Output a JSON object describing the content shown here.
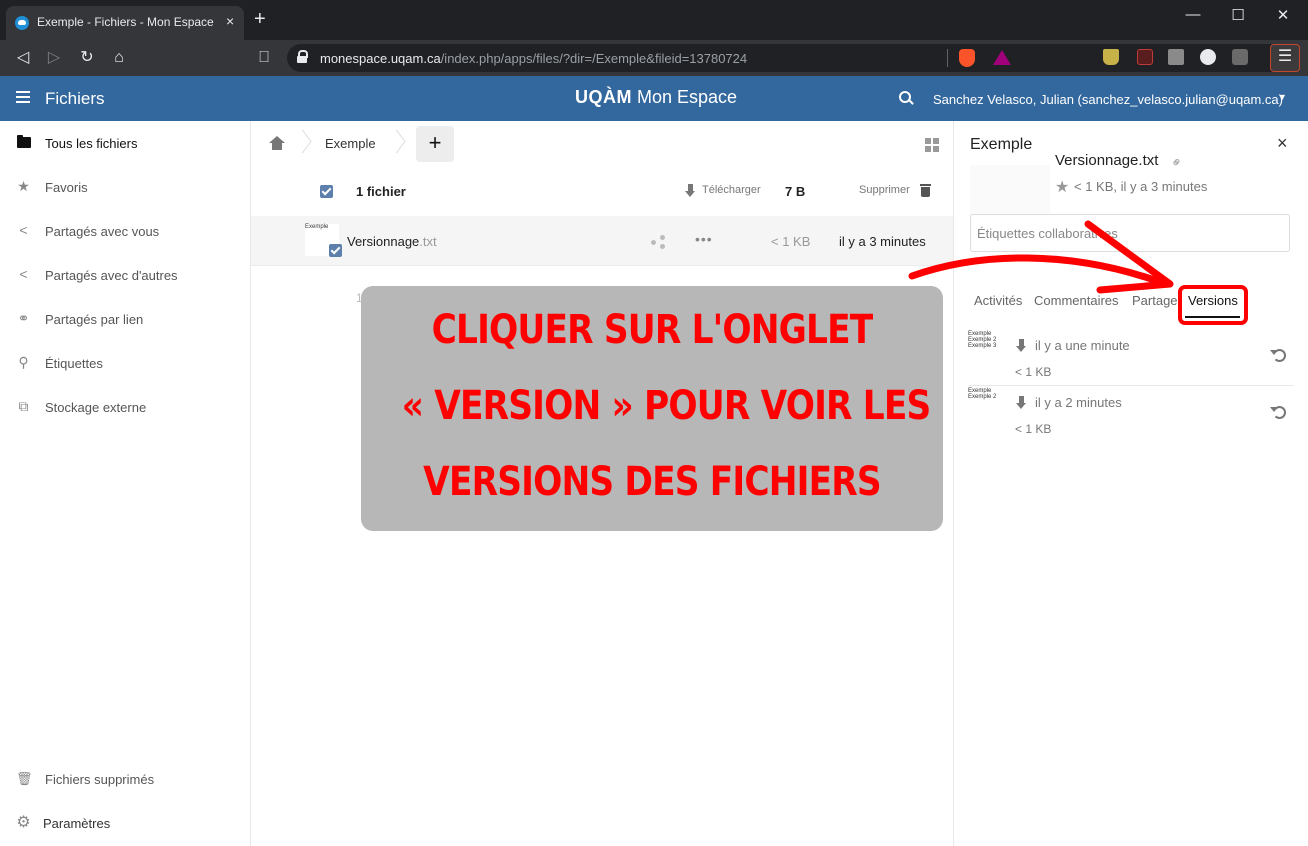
{
  "browser": {
    "tab_title": "Exemple - Fichiers - Mon Espace",
    "tab_close": "×",
    "new_tab": "+",
    "window_controls": {
      "minimize": "—",
      "maximize": "☐",
      "close": "✕"
    },
    "url_host": "monespace.uqam.ca",
    "url_path": "/index.php/apps/files/?dir=/Exemple&fileid=13780724",
    "nav": {
      "back": "◁",
      "forward": "▷",
      "reload": "↻",
      "home": "⌂",
      "bookmark": "⎕"
    },
    "menu_icon": "☰",
    "extension_icons": [
      "flask-icon",
      "pdf-icon",
      "drive-icon",
      "world-icon",
      "copy-icon"
    ]
  },
  "header": {
    "app_name": "Fichiers",
    "logo_strong": "UQÀM",
    "logo_text": "Mon Espace",
    "user": "Sanchez Velasco, Julian (sanchez_velasco.julian@uqam.ca)",
    "user_caret": "▾",
    "colors": {
      "header_bg": "#33689e"
    }
  },
  "sidebar": {
    "items": [
      {
        "label": "Tous les fichiers",
        "icon": "folder-icon",
        "glyph": ""
      },
      {
        "label": "Favoris",
        "icon": "star-icon",
        "glyph": "★"
      },
      {
        "label": "Partagés avec vous",
        "icon": "share-icon",
        "glyph": "<"
      },
      {
        "label": "Partagés avec d'autres",
        "icon": "share-icon",
        "glyph": "<"
      },
      {
        "label": "Partagés par lien",
        "icon": "link-icon",
        "glyph": "⚭"
      },
      {
        "label": "Étiquettes",
        "icon": "tag-icon",
        "glyph": "⚲"
      },
      {
        "label": "Stockage externe",
        "icon": "external-link-icon",
        "glyph": "⧉"
      }
    ],
    "bottom": [
      {
        "label": "Fichiers supprimés",
        "icon": "trash-icon",
        "glyph": "🗑"
      },
      {
        "label": "Paramètres",
        "icon": "gear-icon",
        "glyph": "⚙"
      }
    ]
  },
  "breadcrumb": {
    "folder": "Exemple",
    "add_label": "+"
  },
  "file_list": {
    "selected_count": "1 fichier",
    "download_label": "Télécharger",
    "total_size": "7 B",
    "delete_label": "Supprimer",
    "files": [
      {
        "name": "Versionnage",
        "extension": ".txt",
        "size": "< 1 KB",
        "modified": "il y a 3 minutes",
        "thumb_text": "Exemple",
        "more": "•••"
      }
    ],
    "summary": "1"
  },
  "annotation": {
    "lines": [
      "CLIQUER SUR L'ONGLET",
      "« VERSION » POUR VOIR LES",
      "VERSIONS DES FICHIERS"
    ],
    "color": "#ff0000",
    "box_color": "#b7b7b7"
  },
  "details": {
    "folder_title": "Exemple",
    "close": "×",
    "file_name": "Versionnage.txt",
    "meta": "< 1 KB, il y a 3 minutes",
    "star": "★",
    "link": "⚭",
    "tags_placeholder": "Étiquettes collaboratives",
    "tabs": [
      {
        "label": "Activités"
      },
      {
        "label": "Commentaires"
      },
      {
        "label": "Partage"
      },
      {
        "label": "Versions",
        "active": true
      }
    ],
    "versions": [
      {
        "thumb": "Exemple\nExemple 2\nExemple 3",
        "date": "il y a une minute",
        "size": "< 1 KB"
      },
      {
        "thumb": "Exemple\nExemple 2",
        "date": "il y a 2 minutes",
        "size": "< 1 KB"
      }
    ]
  }
}
